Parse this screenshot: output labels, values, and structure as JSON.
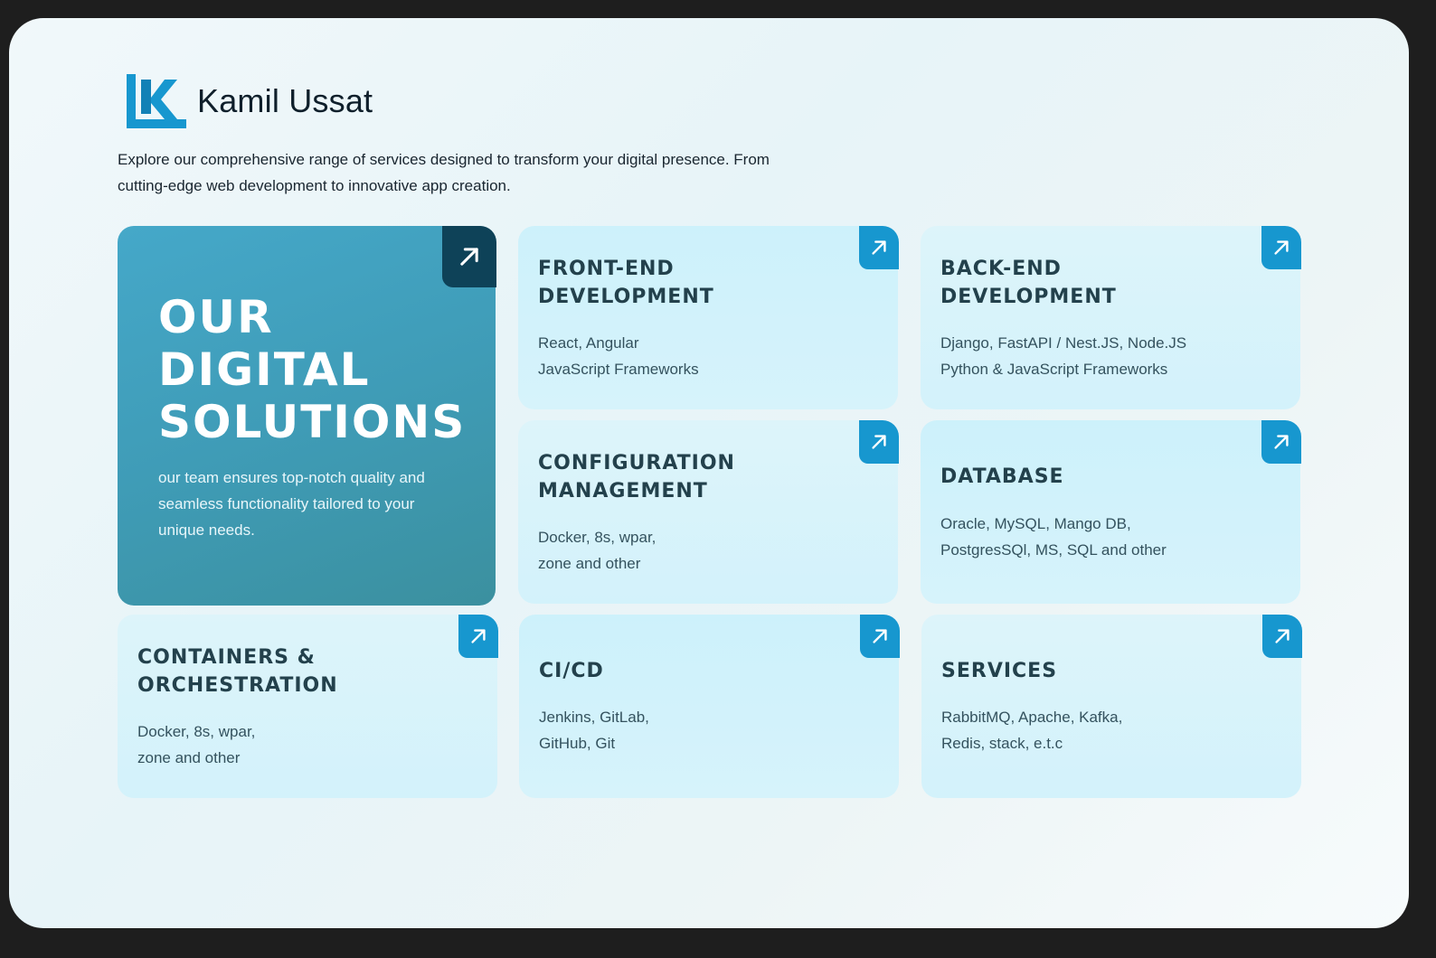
{
  "brand": {
    "name": "Kamil Ussat",
    "logo_icon": "k-logo-icon"
  },
  "intro": "Explore our comprehensive range of services designed to transform your digital presence. From cutting-edge web development to innovative app creation.",
  "hero": {
    "title": "Our\nDigital\nSolutions",
    "description": "our team ensures top-notch quality and seamless functionality tailored to your unique needs.",
    "icon": "arrow-up-right-icon"
  },
  "cards": [
    {
      "title": "Front-End\nDevelopment",
      "desc": "React, Angular\nJavaScript Frameworks"
    },
    {
      "title": "Back-End\nDevelopment",
      "desc": "Django, FastAPI / Nest.JS, Node.JS\nPython & JavaScript Frameworks"
    },
    {
      "title": "Configuration\nManagement",
      "desc": "Docker, 8s, wpar,\nzone and other"
    },
    {
      "title": "Database",
      "desc": "Oracle, MySQL, Mango DB,\nPostgresSQl, MS, SQL and other"
    },
    {
      "title": "Containers &\nOrchestration",
      "desc": "Docker, 8s, wpar,\nzone and other"
    },
    {
      "title": "CI/CD",
      "desc": "Jenkins, GitLab,\nGitHub, Git"
    },
    {
      "title": "Services",
      "desc": "RabbitMQ, Apache, Kafka,\nRedis, stack, e.t.c"
    }
  ],
  "colors": {
    "accent": "#1797cf",
    "hero_corner": "#0e4258",
    "title": "#23414c"
  }
}
